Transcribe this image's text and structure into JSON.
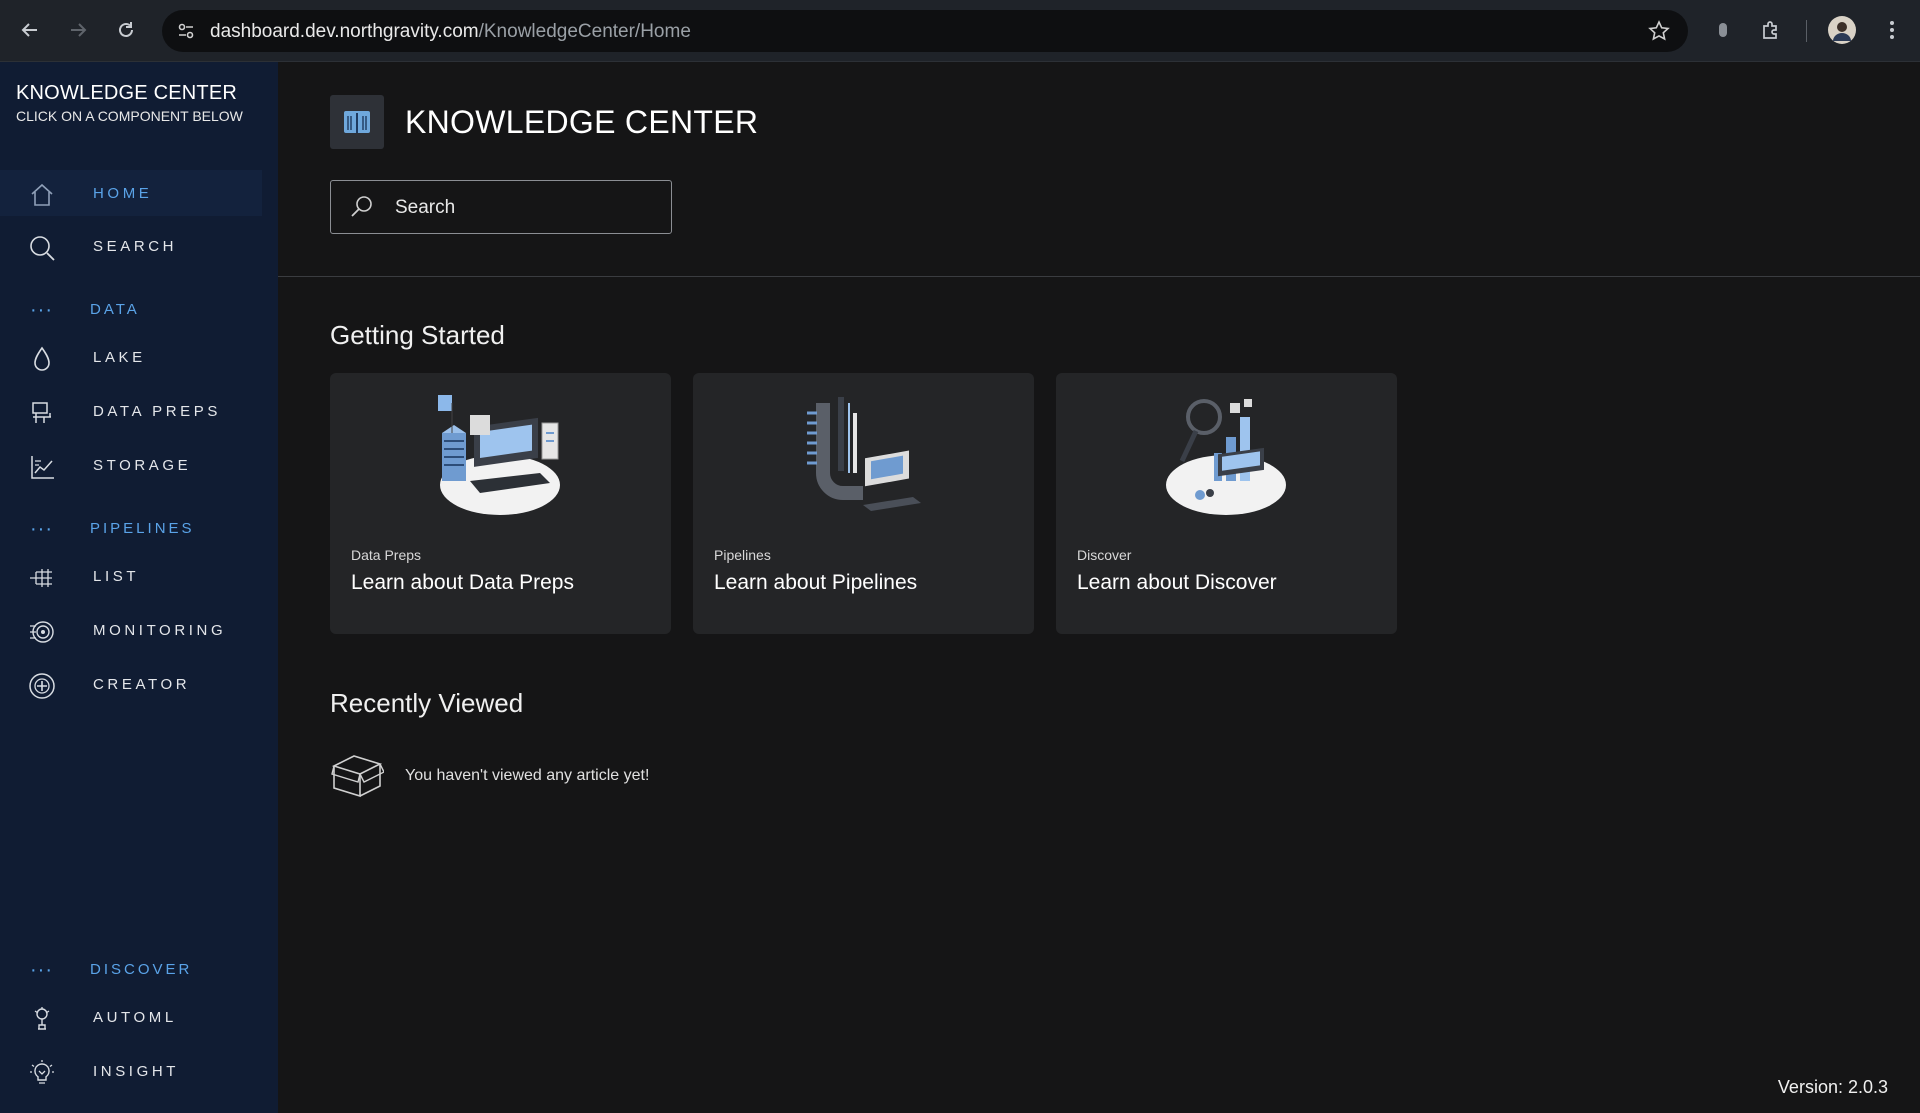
{
  "browser": {
    "url_domain": "dashboard.dev.northgravity.com",
    "url_path": "/KnowledgeCenter/Home",
    "icons": [
      "back-icon",
      "forward-icon",
      "reload-icon",
      "site-settings-icon",
      "star-icon",
      "extension-icon",
      "puzzle-icon",
      "profile-avatar",
      "menu-icon"
    ]
  },
  "sidebar": {
    "title": "KNOWLEDGE CENTER",
    "subtitle": "CLICK ON A COMPONENT BELOW",
    "home": "HOME",
    "search": "SEARCH",
    "section_data": "DATA",
    "lake": "LAKE",
    "data_preps": "DATA PREPS",
    "storage": "STORAGE",
    "section_pipelines": "PIPELINES",
    "list": "LIST",
    "monitoring": "MONITORING",
    "creator": "CREATOR",
    "section_discover": "DISCOVER",
    "automl": "AUTOML",
    "insight": "INSIGHT",
    "section_dots": "···"
  },
  "main": {
    "title": "KNOWLEDGE CENTER",
    "search_placeholder": "Search",
    "getting_started": "Getting Started",
    "cards": [
      {
        "category": "Data Preps",
        "title": "Learn about Data Preps"
      },
      {
        "category": "Pipelines",
        "title": "Learn about Pipelines"
      },
      {
        "category": "Discover",
        "title": "Learn about Discover"
      }
    ],
    "recently_viewed": "Recently Viewed",
    "empty_message": "You haven't viewed any article yet!",
    "version": "Version: 2.0.3"
  },
  "colors": {
    "sidebar_bg": "#101c33",
    "accent": "#5aa3e8",
    "main_bg": "#151516",
    "card_bg": "#242527"
  }
}
